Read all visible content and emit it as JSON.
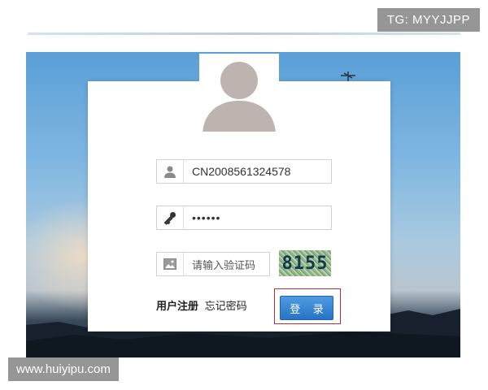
{
  "watermarks": {
    "top_right": "TG: MYYJJPP",
    "bottom_left": "www.huiyipu.com"
  },
  "login_form": {
    "username": {
      "value": "CN2008561324578",
      "icon": "user-icon"
    },
    "password": {
      "masked_value": "••••••",
      "icon": "key-icon"
    },
    "captcha_input": {
      "placeholder": "请输入验证码",
      "icon": "image-icon"
    },
    "captcha_code": "8155",
    "register_link": "用户注册",
    "forgot_password_link": "忘记密码",
    "login_button": "登 录"
  },
  "colors": {
    "login_button": "#2f7fd0",
    "highlight_box": "#b2323a",
    "avatar_silhouette": "#bdb4b0"
  }
}
